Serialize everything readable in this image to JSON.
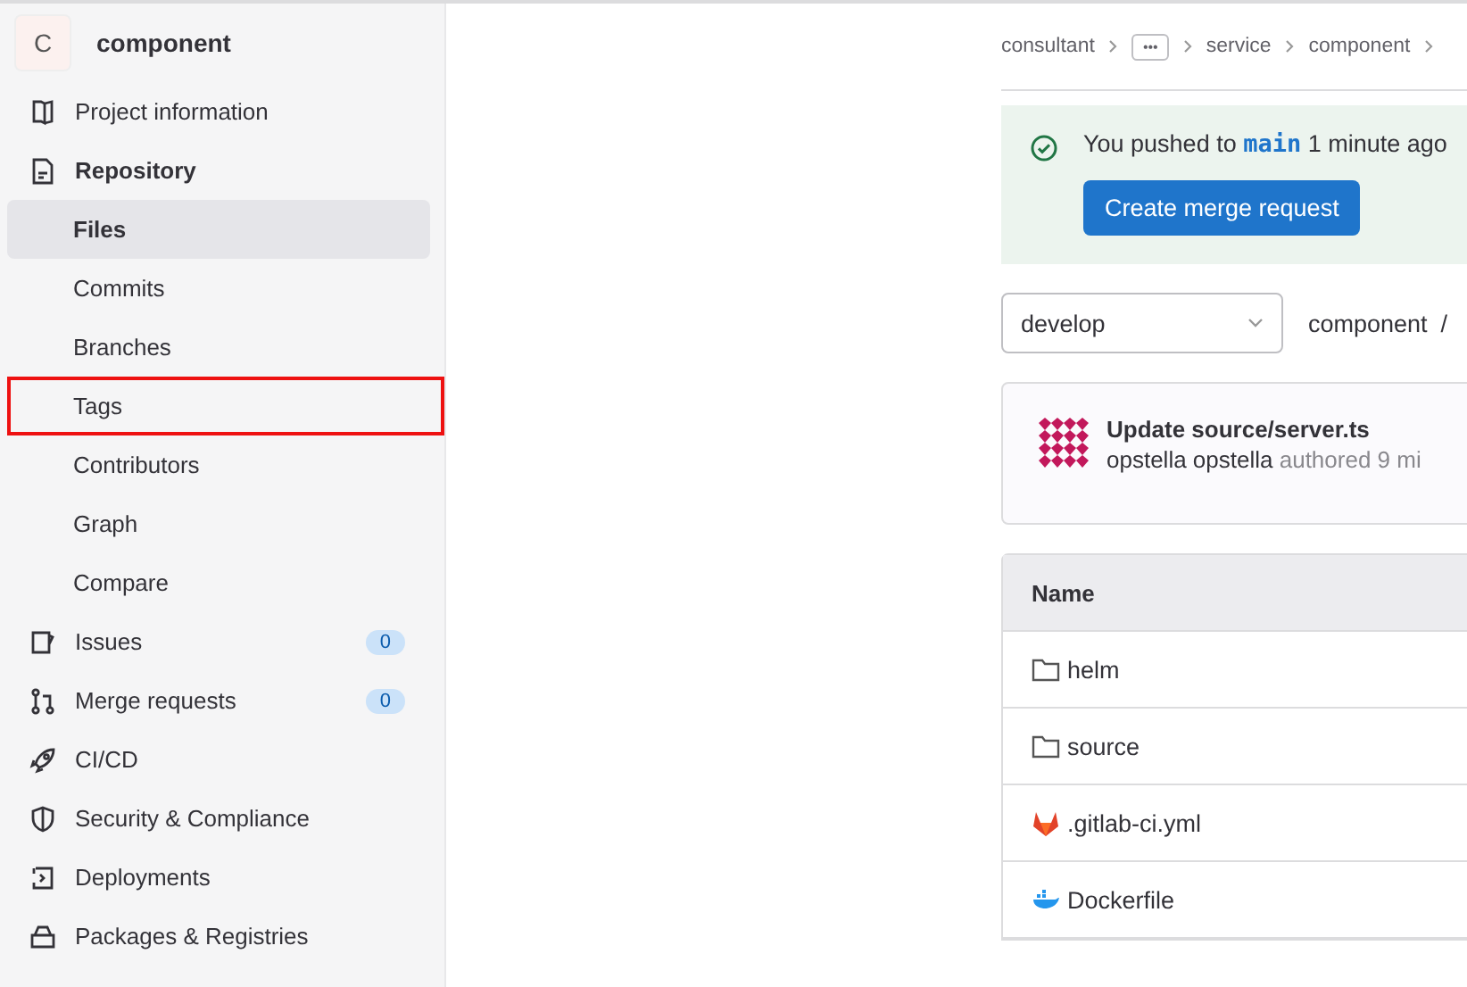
{
  "project": {
    "avatar_letter": "C",
    "name": "component"
  },
  "sidebar": {
    "items": [
      {
        "label": "Project information",
        "kind": "section",
        "selected": false,
        "highlighted": false
      },
      {
        "label": "Repository",
        "kind": "section-open",
        "selected": false,
        "highlighted": false
      },
      {
        "label": "Files",
        "kind": "sub",
        "selected": true,
        "highlighted": false
      },
      {
        "label": "Commits",
        "kind": "sub",
        "selected": false,
        "highlighted": false
      },
      {
        "label": "Branches",
        "kind": "sub",
        "selected": false,
        "highlighted": false
      },
      {
        "label": "Tags",
        "kind": "sub",
        "selected": false,
        "highlighted": true
      },
      {
        "label": "Contributors",
        "kind": "sub",
        "selected": false,
        "highlighted": false
      },
      {
        "label": "Graph",
        "kind": "sub",
        "selected": false,
        "highlighted": false
      },
      {
        "label": "Compare",
        "kind": "sub",
        "selected": false,
        "highlighted": false
      },
      {
        "label": "Issues",
        "kind": "section",
        "count": "0",
        "selected": false,
        "highlighted": false
      },
      {
        "label": "Merge requests",
        "kind": "section",
        "count": "0",
        "selected": false,
        "highlighted": false
      },
      {
        "label": "CI/CD",
        "kind": "section",
        "selected": false,
        "highlighted": false
      },
      {
        "label": "Security & Compliance",
        "kind": "section",
        "selected": false,
        "highlighted": false
      },
      {
        "label": "Deployments",
        "kind": "section",
        "selected": false,
        "highlighted": false
      },
      {
        "label": "Packages & Registries",
        "kind": "section",
        "selected": false,
        "highlighted": false
      }
    ]
  },
  "breadcrumbs": [
    "consultant",
    "•••",
    "service",
    "component"
  ],
  "push_alert": {
    "text": "You pushed to **main** 1 minute ago",
    "button": "Create merge request"
  },
  "branch_select": {
    "value": "develop"
  },
  "path": "component  /",
  "commit": {
    "title": "Update source/server.ts",
    "author": "opstella opstella",
    "meta": "authored 9 mi"
  },
  "file_table": {
    "columns": [
      "Name"
    ],
    "rows": [
      {
        "name": "helm",
        "kind": "folder"
      },
      {
        "name": "source",
        "kind": "folder"
      },
      {
        "name": ".gitlab-ci.yml",
        "kind": "gitlab"
      },
      {
        "name": "Dockerfile",
        "kind": "docker"
      }
    ]
  }
}
